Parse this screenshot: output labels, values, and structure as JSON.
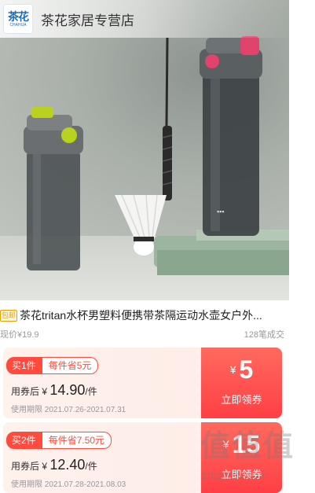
{
  "shop": {
    "logo_text": "茶花",
    "logo_subtext": "CHAHUA",
    "name": "茶花家居专营店"
  },
  "product": {
    "tag": "包邮",
    "title": "茶花tritan水杯男塑料便携带茶隔运动水壶女户外...",
    "current_price": "现价¥19.9",
    "sales": "128笔成交"
  },
  "coupons": [
    {
      "qty_label": "买1件",
      "save_label": "每件省5元",
      "after_prefix": "用券后 ¥ ",
      "after_price": "14.90",
      "after_unit": "/件",
      "period": "使用期限 2021.07.26-2021.07.31",
      "currency": "¥",
      "amount": "5",
      "claim": "立即领券"
    },
    {
      "qty_label": "买2件",
      "save_label": "每件省7.50元",
      "after_prefix": "用券后 ¥ ",
      "after_price": "12.40",
      "after_unit": "/件",
      "period": "使用期限 2021.07.28-2021.08.03",
      "currency": "¥",
      "amount": "15",
      "claim": "立即领券"
    }
  ],
  "watermark": {
    "text": "值值值",
    "url": "zhizhizhi.com"
  },
  "colors": {
    "accent": "#ff4a3d",
    "tag": "#e8a200",
    "bottle_accent_left": "#b8d21e",
    "bottle_accent_right": "#e0436b"
  }
}
